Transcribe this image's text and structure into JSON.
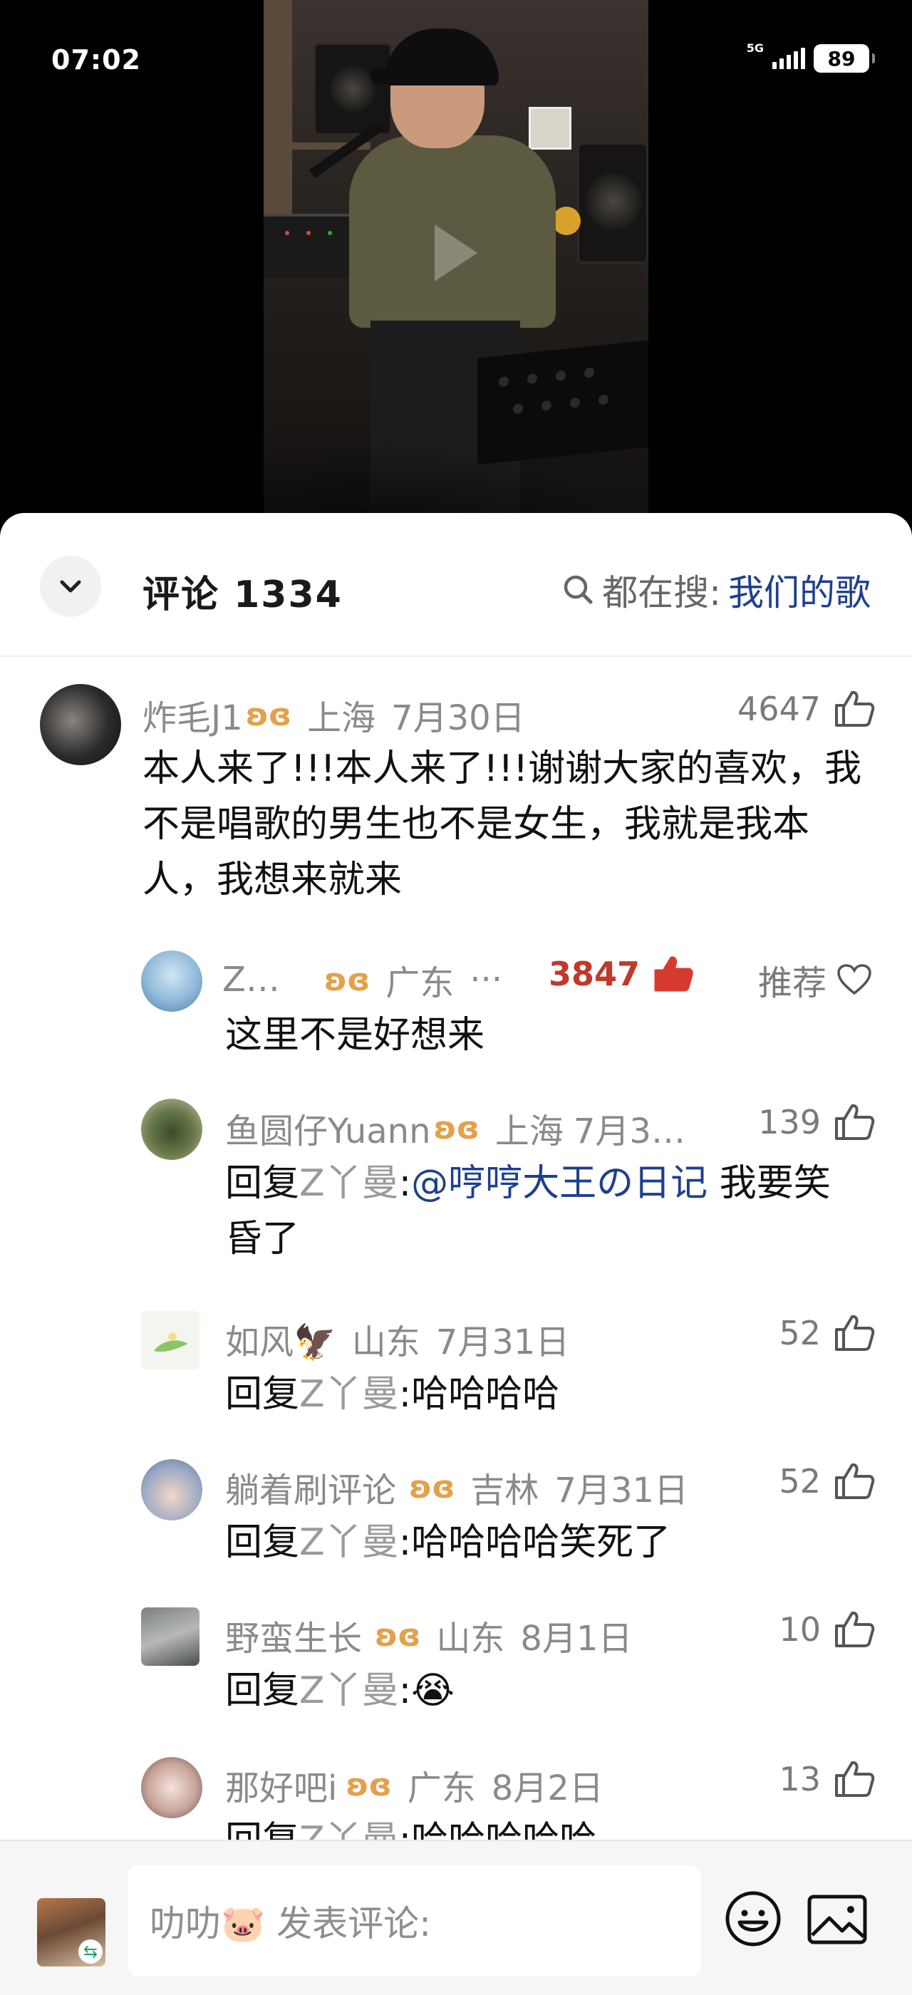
{
  "status_bar": {
    "time": "07:02",
    "network": "5G",
    "battery": "89"
  },
  "comments_header": {
    "title": "评论 1334",
    "trend_label": "都在搜:",
    "trend_keyword": "我们的歌"
  },
  "comments": [
    {
      "name": "炸毛J1",
      "badge": "ʚɞ",
      "location": "上海",
      "date": "7月30日",
      "likes": "4647",
      "text": "本人来了!!!本人来了!!!谢谢大家的喜欢，我不是唱歌的男生也不是女生，我就是我本人，我想来就来"
    }
  ],
  "replies": [
    {
      "name": "Z…",
      "badge": "ʚɞ",
      "location": "广东",
      "more": "···",
      "likes": "3847",
      "recommend": "推荐",
      "text": "这里不是好想来"
    },
    {
      "name": "鱼圆仔Yuann",
      "badge": "ʚɞ",
      "location": "上海",
      "date": "7月3…",
      "likes": "139",
      "reply_prefix": "回复",
      "reply_to": "Z丫曼",
      "colon": ":",
      "mention": "@哼哼大王の日记",
      "text": " 我要笑昏了"
    },
    {
      "name": "如风🦅",
      "location": "山东",
      "date": "7月31日",
      "likes": "52",
      "reply_prefix": "回复",
      "reply_to": "Z丫曼",
      "colon": ":",
      "text": "哈哈哈哈"
    },
    {
      "name": "躺着刷评论",
      "badge": "ʚɞ",
      "location": "吉林",
      "date": "7月31日",
      "likes": "52",
      "reply_prefix": "回复",
      "reply_to": "Z丫曼",
      "colon": ":",
      "text": "哈哈哈哈笑死了"
    },
    {
      "name": "野蛮生长",
      "badge": "ʚɞ",
      "location": "山东",
      "date": "8月1日",
      "likes": "10",
      "reply_prefix": "回复",
      "reply_to": "Z丫曼",
      "colon": ":",
      "text": "😭"
    },
    {
      "name": "那好吧i",
      "badge": "ʚɞ",
      "location": "广东",
      "date": "8月2日",
      "likes": "13",
      "reply_prefix": "回复",
      "reply_to": "Z丫曼",
      "colon": ":",
      "text": "哈哈哈哈哈"
    }
  ],
  "input_bar": {
    "placeholder": "叻叻🐷 发表评论:"
  },
  "icons": {
    "collapse": "chevron-down-icon",
    "search": "search-icon",
    "like": "thumbs-up-icon",
    "like_active": "thumbs-up-filled-icon",
    "favorite": "heart-icon",
    "emoji": "emoji-icon",
    "image": "image-icon",
    "play": "play-icon"
  },
  "colors": {
    "link_blue": "#1d3f8f",
    "hot_like_red": "#c0392b",
    "badge_orange": "#e2a14a",
    "sheet_background": "#ffffff",
    "video_background": "#000000"
  }
}
